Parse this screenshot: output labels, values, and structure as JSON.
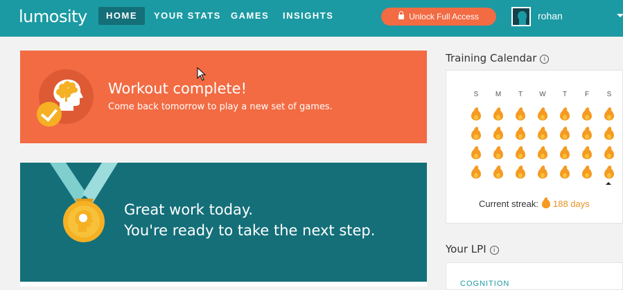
{
  "header": {
    "logo": "lumosity",
    "nav": [
      {
        "label": "HOME",
        "active": true
      },
      {
        "label": "YOUR STATS",
        "active": false
      },
      {
        "label": "GAMES",
        "active": false
      },
      {
        "label": "INSIGHTS",
        "active": false
      }
    ],
    "unlock_label": "Unlock Full Access",
    "username": "rohan"
  },
  "workout_card": {
    "title": "Workout complete!",
    "subtitle": "Come back tomorrow to play a new set of games.",
    "icon": "brain-head-icon",
    "badge_icon": "checkmark-icon"
  },
  "great_work_card": {
    "line1": "Great work today.",
    "line2": "You're ready to take the next step.",
    "icon": "medal-icon"
  },
  "training_calendar": {
    "title": "Training Calendar",
    "info_glyph": "i",
    "days": [
      "S",
      "M",
      "T",
      "W",
      "T",
      "F",
      "S"
    ],
    "weeks": 4,
    "day_icon": "flame-icon",
    "streak_label": "Current streak:",
    "streak_value": "188 days"
  },
  "lpi": {
    "title": "Your LPI",
    "info_glyph": "i",
    "category": "COGNITION"
  },
  "colors": {
    "header": "#1b9aa3",
    "nav_active": "#146f79",
    "accent_orange": "#f26b43",
    "teal_card": "#146f79",
    "flame": "#f59a22",
    "medal_gold": "#f5b024"
  }
}
